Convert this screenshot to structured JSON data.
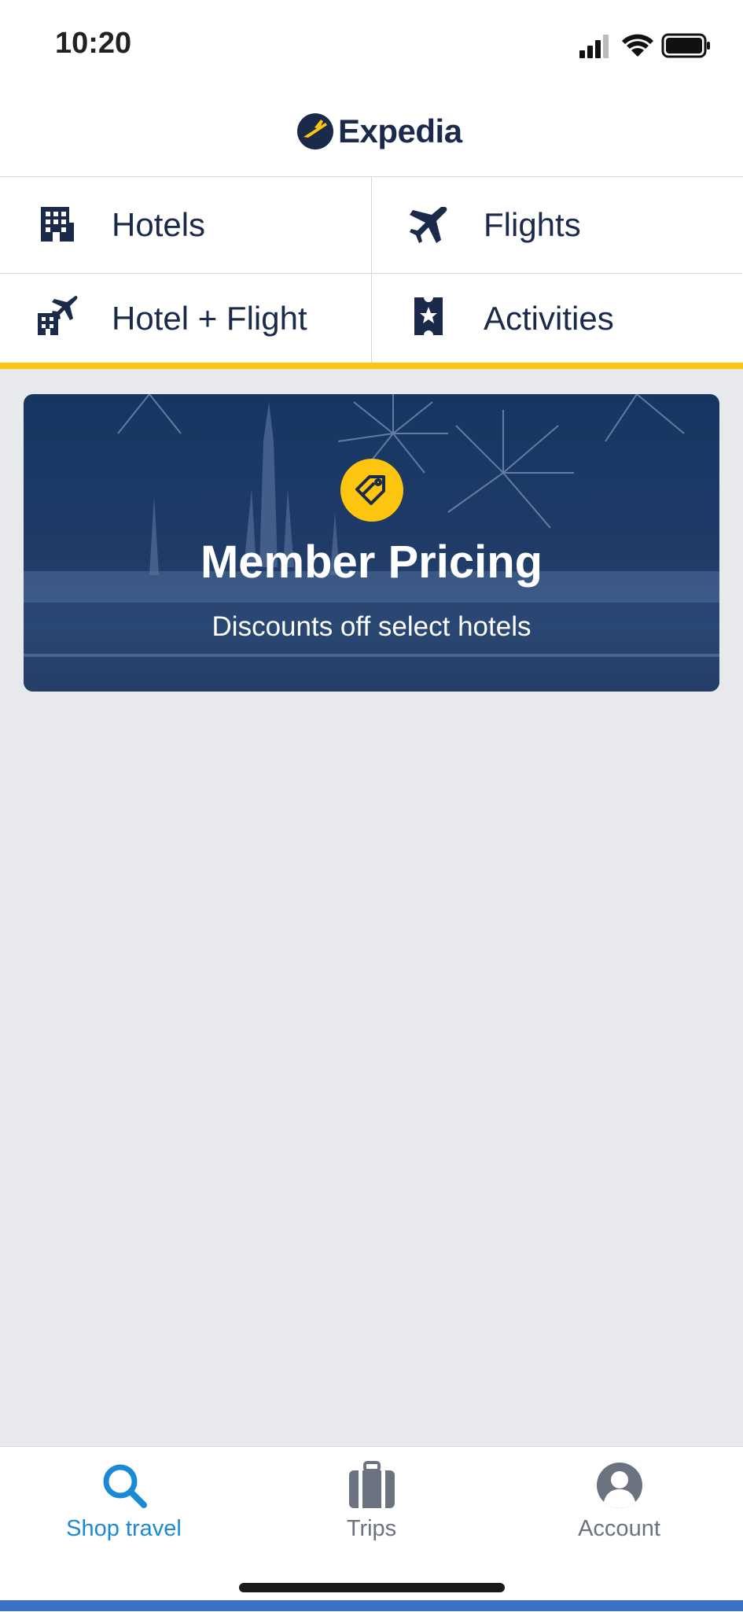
{
  "status_bar": {
    "time": "10:20"
  },
  "header": {
    "logo_text": "Expedia"
  },
  "nav": {
    "items": [
      {
        "label": "Hotels",
        "icon": "hotel-icon"
      },
      {
        "label": "Flights",
        "icon": "airplane-icon"
      },
      {
        "label": "Hotel + Flight",
        "icon": "hotel-flight-icon"
      },
      {
        "label": "Activities",
        "icon": "ticket-star-icon"
      }
    ]
  },
  "banner": {
    "title": "Member Pricing",
    "subtitle": "Discounts off select hotels",
    "icon": "price-tags-icon"
  },
  "tab_bar": {
    "tabs": [
      {
        "label": "Shop travel",
        "icon": "search-icon",
        "active": true
      },
      {
        "label": "Trips",
        "icon": "briefcase-icon",
        "active": false
      },
      {
        "label": "Account",
        "icon": "account-icon",
        "active": false
      }
    ]
  },
  "colors": {
    "accent_yellow": "#fcc50f",
    "brand_navy": "#1b2a4a",
    "active_blue": "#1b8ad6"
  }
}
